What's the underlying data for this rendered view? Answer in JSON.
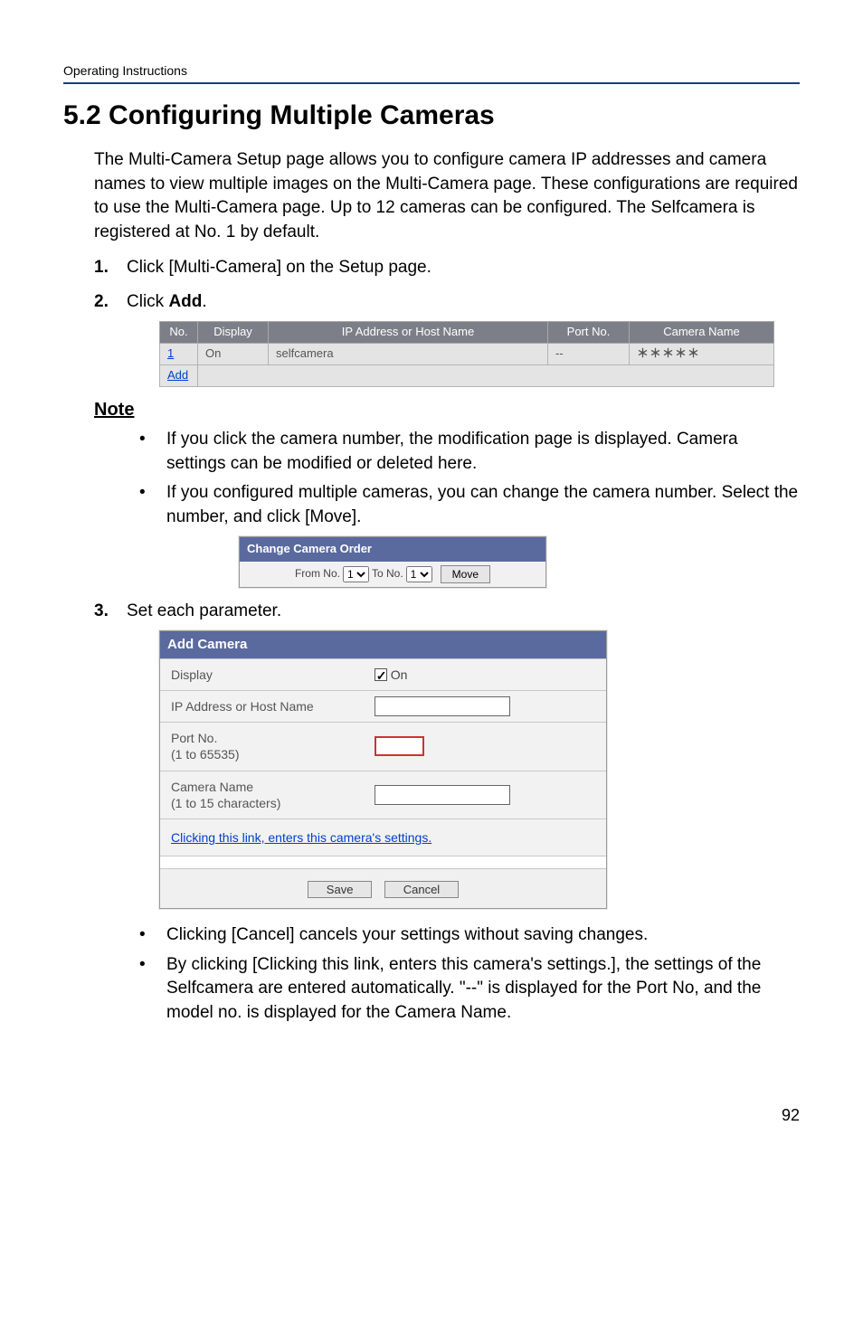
{
  "running_header": "Operating Instructions",
  "section_title": "5.2   Configuring Multiple Cameras",
  "intro": "The Multi-Camera Setup page allows you to configure camera IP addresses and camera names to view multiple images on the Multi-Camera page. These configurations are required to use the Multi-Camera page. Up to 12 cameras can be configured. The Selfcamera is registered at No. 1 by default.",
  "steps": {
    "s1": "Click [Multi-Camera] on the Setup page.",
    "s2_prefix": "Click ",
    "s2_bold": "Add",
    "s2_suffix": ".",
    "s3": "Set each parameter."
  },
  "cam_table": {
    "headers": {
      "no": "No.",
      "display": "Display",
      "ip": "IP Address or Host Name",
      "port": "Port No.",
      "name": "Camera Name"
    },
    "rows": [
      {
        "no": "1",
        "display": "On",
        "ip": "selfcamera",
        "port": "--",
        "name": "＊＊＊＊＊"
      }
    ],
    "add_label": "Add"
  },
  "note_heading": "Note",
  "note_bullets": {
    "b1": "If you click the camera number, the modification page is displayed. Camera settings can be modified or deleted here.",
    "b2": "If you configured multiple cameras, you can change the camera number. Select the number, and click [Move]."
  },
  "order_panel": {
    "title": "Change Camera Order",
    "from_label": "From No.",
    "to_label": "To No.",
    "from_value": "1",
    "to_value": "1",
    "move_label": "Move"
  },
  "add_panel": {
    "title": "Add Camera",
    "display_label": "Display",
    "display_value": "On",
    "ip_label": "IP Address or Host Name",
    "port_label": "Port No.",
    "port_hint": "(1 to 65535)",
    "name_label": "Camera Name",
    "name_hint": "(1 to 15 characters)",
    "link_text": "Clicking this link, enters this camera's settings.",
    "save_label": "Save",
    "cancel_label": "Cancel"
  },
  "post_bullets": {
    "b1": "Clicking [Cancel] cancels your settings without saving changes.",
    "b2": "By clicking [Clicking this link, enters this camera's settings.], the settings of the Selfcamera are entered automatically. \"--\" is displayed for the Port No, and the model no. is displayed for the Camera Name."
  },
  "page_number": "92"
}
